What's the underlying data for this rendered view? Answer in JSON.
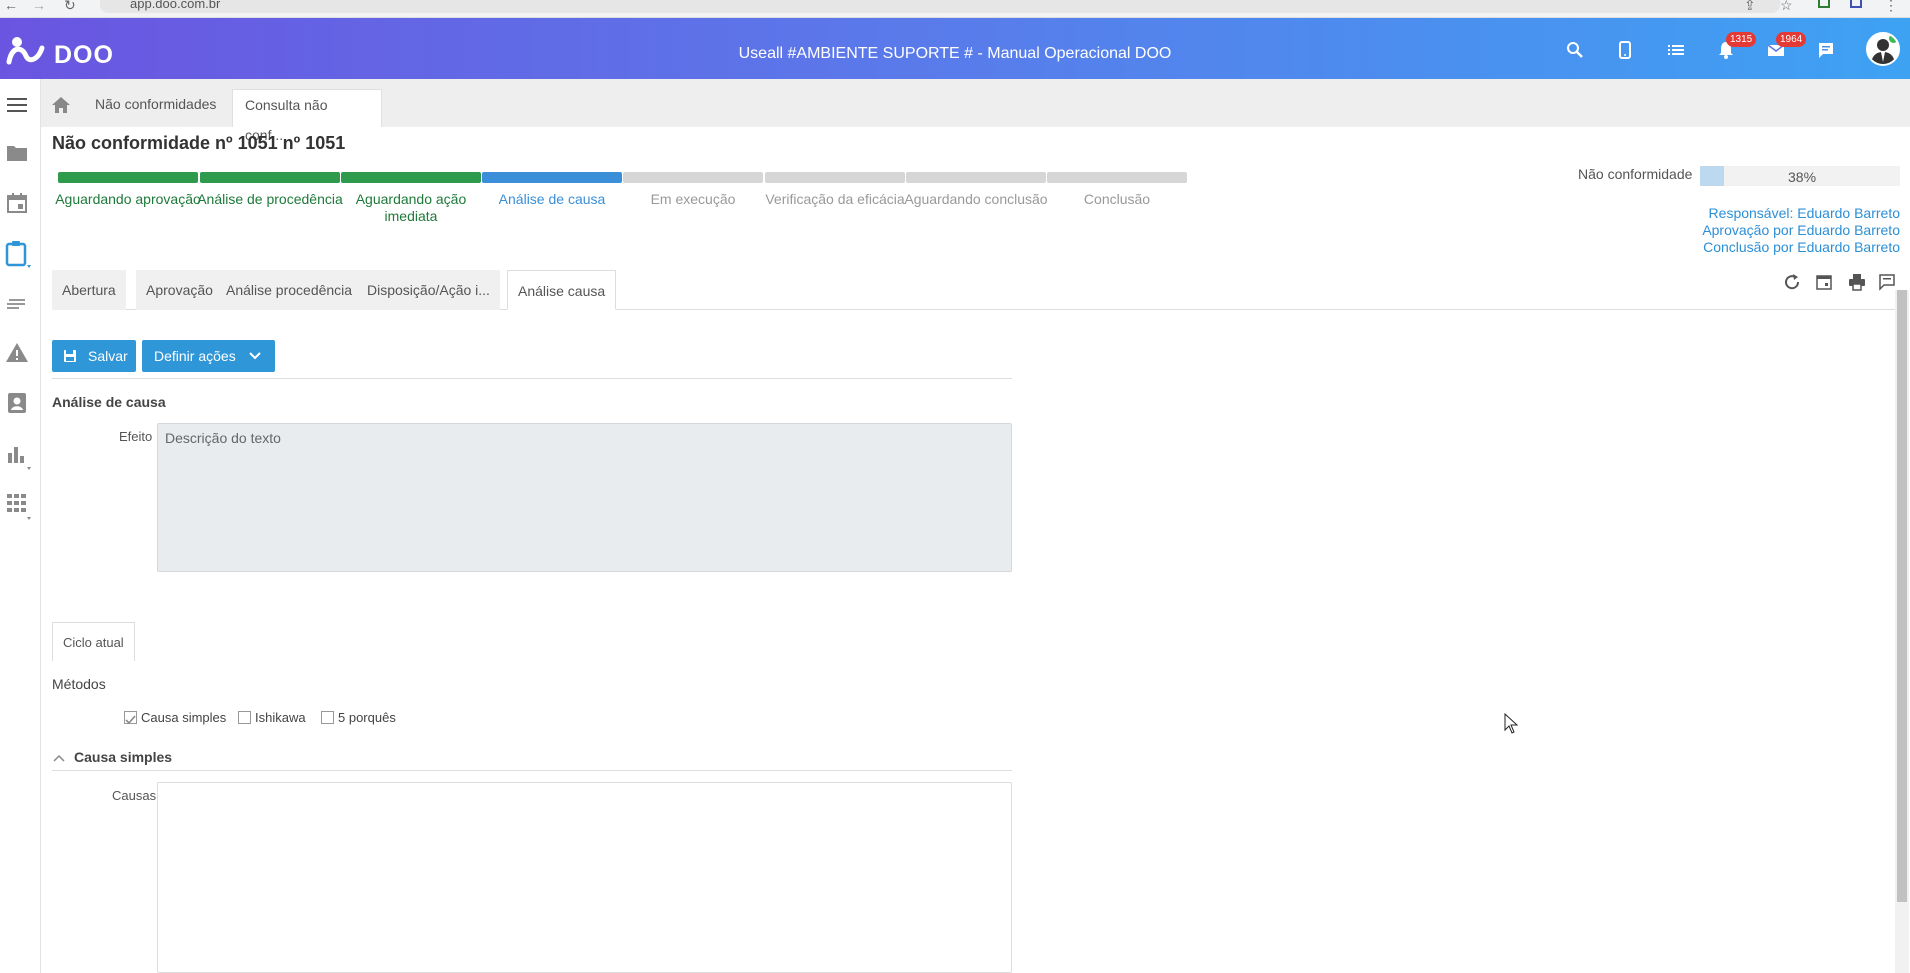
{
  "browser": {
    "url": "app.doo.com.br"
  },
  "header": {
    "logo": "DOO",
    "title": "Useall #AMBIENTE SUPORTE # - Manual Operacional DOO",
    "notifications_count": "1315",
    "messages_count": "1964",
    "icons": [
      "search-icon",
      "mobile-icon",
      "list-icon",
      "bell-icon",
      "mail-icon",
      "chat-icon",
      "avatar"
    ]
  },
  "sidebar": {
    "icons": [
      "menu-icon",
      "folder-icon",
      "calendar-icon",
      "clipboard-icon",
      "lines-icon",
      "warning-icon",
      "contact-icon",
      "chart-icon",
      "grid-icon"
    ]
  },
  "breadcrumb": {
    "items": [
      "Não conformidades",
      "Consulta não conf..."
    ]
  },
  "page": {
    "title": "Não conformidade nº 1051 nº 1051"
  },
  "progress": {
    "steps": [
      {
        "label": "Aguardando aprovação",
        "status": "done"
      },
      {
        "label": "Análise de procedência",
        "status": "done"
      },
      {
        "label": "Aguardando ação imediata",
        "status": "done"
      },
      {
        "label": "Análise de causa",
        "status": "current"
      },
      {
        "label": "Em execução",
        "status": "pending"
      },
      {
        "label": "Verificação da eficácia",
        "status": "pending"
      },
      {
        "label": "Aguardando conclusão",
        "status": "pending"
      },
      {
        "label": "Conclusão",
        "status": "pending"
      }
    ],
    "colors": {
      "done": "#2e9a4b",
      "current": "#3a8fd8",
      "pending": "#d6d6d6",
      "done_text": "#1e7a3a",
      "current_text": "#3a8fd8",
      "pending_text": "#999999"
    }
  },
  "status_panel": {
    "label": "Não conformidade",
    "percent_text": "38%",
    "percent": 38,
    "responsavel": "Responsável: Eduardo Barreto",
    "aprovacao": "Aprovação por Eduardo Barreto",
    "conclusao": "Conclusão por Eduardo Barreto"
  },
  "tabs": [
    {
      "label": "Abertura"
    },
    {
      "label": "Aprovação"
    },
    {
      "label": "Análise procedência"
    },
    {
      "label": "Disposição/Ação i..."
    },
    {
      "label": "Análise causa",
      "active": true
    }
  ],
  "toolbar": {
    "save_label": "Salvar",
    "actions_label": "Definir ações"
  },
  "form": {
    "section_title": "Análise de causa",
    "efeito_label": "Efeito",
    "efeito_placeholder": "Descrição do texto",
    "cycle_tab": "Ciclo atual",
    "methods_title": "Métodos",
    "methods": [
      {
        "label": "Causa simples",
        "checked": true
      },
      {
        "label": "Ishikawa",
        "checked": false
      },
      {
        "label": "5 porquês",
        "checked": false
      }
    ],
    "causa_section": "Causa simples",
    "causas_label": "Causas"
  }
}
